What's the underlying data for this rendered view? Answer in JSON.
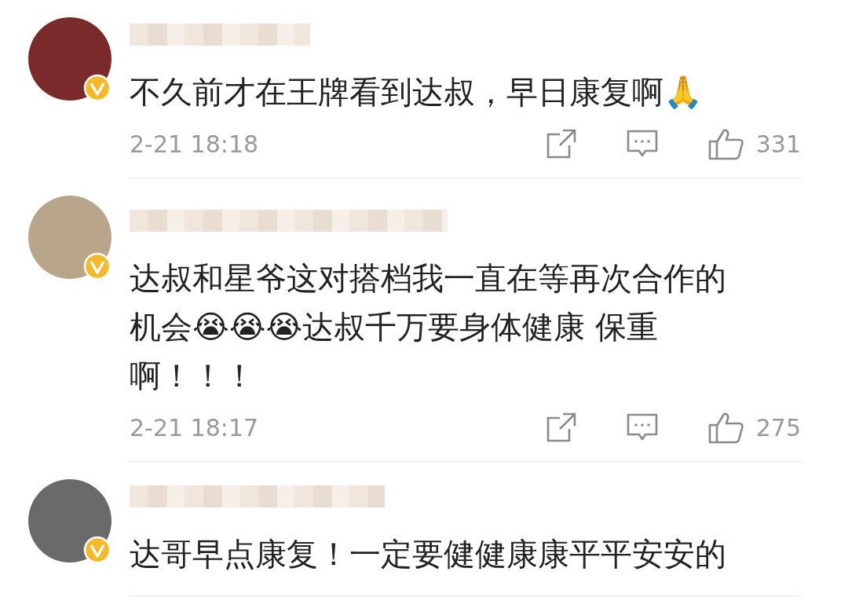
{
  "comments": [
    {
      "text": "不久前才在王牌看到达叔，早日康复啊🙏",
      "time": "2-21 18:18",
      "likes": "331"
    },
    {
      "text": "达叔和星爷这对搭档我一直在等再次合作的机会😭😭😭达叔千万要身体健康 保重啊！！！",
      "time": "2-21 18:17",
      "likes": "275"
    },
    {
      "text": "达哥早点康复！一定要健健康康平平安安的"
    }
  ]
}
